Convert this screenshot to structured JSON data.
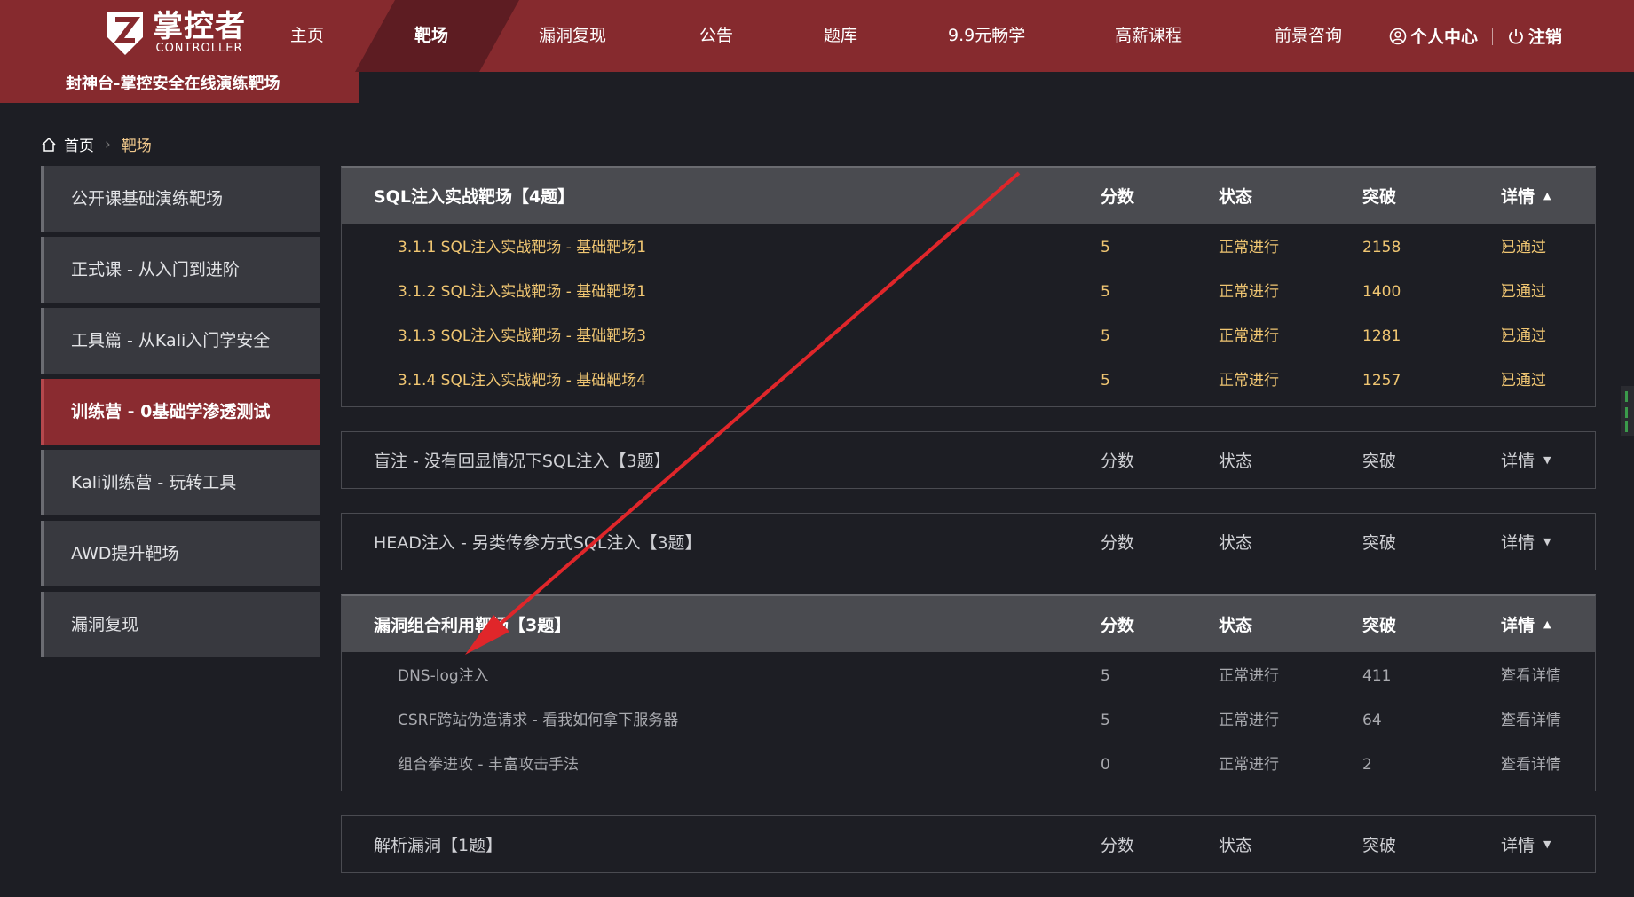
{
  "brand": {
    "name_cn": "掌控者",
    "name_en": "CONTROLLER",
    "subtitle": "封神台-掌控安全在线演练靶场"
  },
  "nav": [
    {
      "label": "主页",
      "active": false
    },
    {
      "label": "靶场",
      "active": true
    },
    {
      "label": "漏洞复现",
      "active": false
    },
    {
      "label": "公告",
      "active": false
    },
    {
      "label": "题库",
      "active": false
    },
    {
      "label": "9.9元畅学",
      "active": false
    },
    {
      "label": "高薪课程",
      "active": false
    },
    {
      "label": "前景咨询",
      "active": false
    }
  ],
  "user": {
    "center": "个人中心",
    "logout": "注销"
  },
  "breadcrumb": {
    "home": "首页",
    "current": "靶场"
  },
  "sidebar": [
    {
      "label": "公开课基础演练靶场",
      "active": false
    },
    {
      "label": "正式课 - 从入门到进阶",
      "active": false
    },
    {
      "label": "工具篇 - 从Kali入门学安全",
      "active": false
    },
    {
      "label": "训练营 - 0基础学渗透测试",
      "active": true
    },
    {
      "label": "Kali训练营 - 玩转工具",
      "active": false
    },
    {
      "label": "AWD提升靶场",
      "active": false
    },
    {
      "label": "漏洞复现",
      "active": false
    }
  ],
  "columns": {
    "score": "分数",
    "status": "状态",
    "solved": "突破",
    "detail": "详情"
  },
  "panels": [
    {
      "title": "SQL注入实战靶场【4题】",
      "open": true,
      "style": "gold",
      "rows": [
        {
          "name": "3.1.1 SQL注入实战靶场 - 基础靶场1",
          "score": "5",
          "status": "正常进行",
          "solved": "2158",
          "action": "已通过"
        },
        {
          "name": "3.1.2 SQL注入实战靶场 - 基础靶场1",
          "score": "5",
          "status": "正常进行",
          "solved": "1400",
          "action": "已通过"
        },
        {
          "name": "3.1.3 SQL注入实战靶场 - 基础靶场3",
          "score": "5",
          "status": "正常进行",
          "solved": "1281",
          "action": "已通过"
        },
        {
          "name": "3.1.4 SQL注入实战靶场 - 基础靶场4",
          "score": "5",
          "status": "正常进行",
          "solved": "1257",
          "action": "已通过"
        }
      ]
    },
    {
      "title": "盲注 - 没有回显情况下SQL注入【3题】",
      "open": false,
      "style": "",
      "rows": []
    },
    {
      "title": "HEAD注入 - 另类传参方式SQL注入【3题】",
      "open": false,
      "style": "",
      "rows": []
    },
    {
      "title": "漏洞组合利用靶场【3题】",
      "open": true,
      "style": "gray",
      "rows": [
        {
          "name": "DNS-log注入",
          "score": "5",
          "status": "正常进行",
          "solved": "411",
          "action": "查看详情"
        },
        {
          "name": "CSRF跨站伪造请求 - 看我如何拿下服务器",
          "score": "5",
          "status": "正常进行",
          "solved": "64",
          "action": "查看详情"
        },
        {
          "name": "组合拳进攻 - 丰富攻击手法",
          "score": "0",
          "status": "正常进行",
          "solved": "2",
          "action": "查看详情"
        }
      ]
    },
    {
      "title": "解析漏洞【1题】",
      "open": false,
      "style": "",
      "rows": []
    }
  ],
  "colors": {
    "header": "#862a2e",
    "active_tab": "#5d1c22",
    "sidebar_active": "#8a2b30",
    "accent_gold": "#f0c672",
    "arrow": "#e0262a"
  },
  "icons": {
    "home": "home-icon",
    "user": "user-circle-icon",
    "power": "power-icon",
    "chevron": "chevron-right-icon"
  }
}
